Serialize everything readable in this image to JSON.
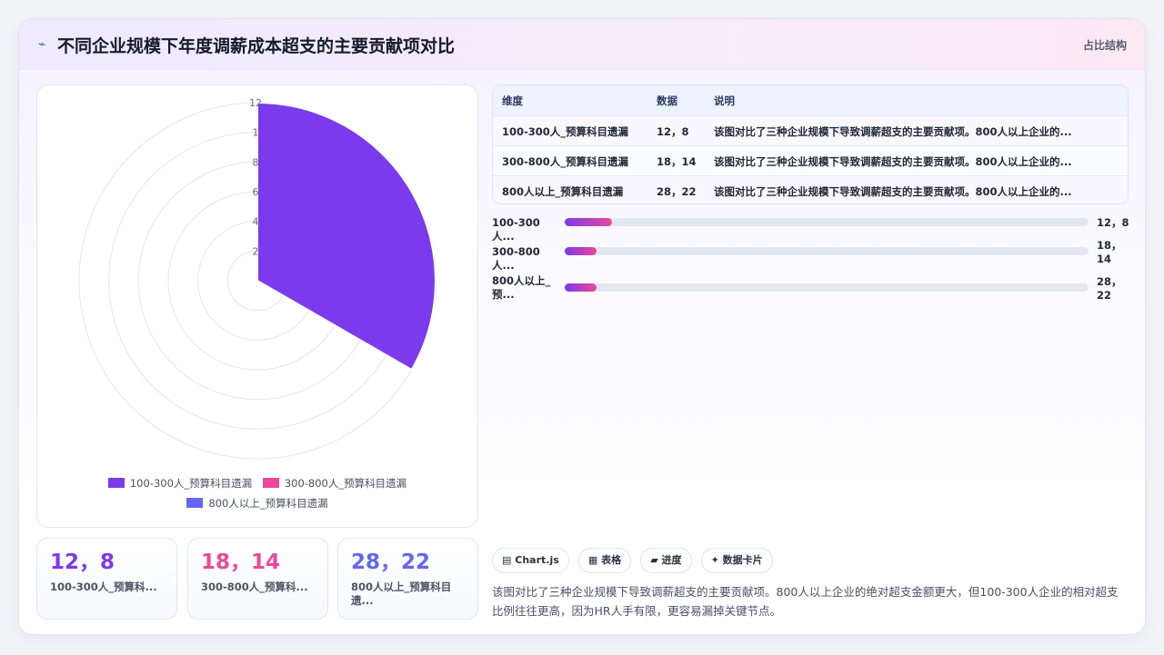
{
  "header": {
    "icon": "trend-icon",
    "title": "不同企业规模下年度调薪成本超支的主要贡献项对比",
    "tag": "占比结构"
  },
  "chart_data": {
    "type": "polarArea",
    "categories": [
      "100-300人_预算科目遗漏",
      "300-800人_预算科目遗漏",
      "800人以上_预算科目遗漏"
    ],
    "values": [
      12,
      18,
      28
    ],
    "colors": [
      "#7c3aed",
      "#ec4899",
      "#6366f1"
    ],
    "r_ticks": [
      "2",
      "4",
      "6",
      "8",
      "1",
      "12"
    ],
    "r_max": 12,
    "legend_position": "bottom",
    "grid": true
  },
  "legend": [
    {
      "label": "100-300人_预算科目遗漏",
      "color": "#7c3aed"
    },
    {
      "label": "300-800人_预算科目遗漏",
      "color": "#ec4899"
    },
    {
      "label": "800人以上_预算科目遗漏",
      "color": "#6366f1"
    }
  ],
  "kpis": [
    {
      "value": "12，8",
      "label": "100-300人_预算科...",
      "color": "#7c3aed"
    },
    {
      "value": "18，14",
      "label": "300-800人_预算科...",
      "color": "#ec4899"
    },
    {
      "value": "28，22",
      "label": "800人以上_预算科目遗...",
      "color": "#6366f1"
    }
  ],
  "table": {
    "headers": [
      "维度",
      "数据",
      "说明"
    ],
    "rows": [
      [
        "100-300人_预算科目遗漏",
        "12，8",
        "该图对比了三种企业规模下导致调薪超支的主要贡献项。800人以上企业的..."
      ],
      [
        "300-800人_预算科目遗漏",
        "18，14",
        "该图对比了三种企业规模下导致调薪超支的主要贡献项。800人以上企业的..."
      ],
      [
        "800人以上_预算科目遗漏",
        "28，22",
        "该图对比了三种企业规模下导致调薪超支的主要贡献项。800人以上企业的..."
      ]
    ]
  },
  "bars": [
    {
      "label": "100-300人...",
      "value": "12，8",
      "fraction": 0.09
    },
    {
      "label": "300-800人...",
      "value": "18，14",
      "fraction": 0.06
    },
    {
      "label": "800人以上_预...",
      "value": "28，22",
      "fraction": 0.06
    }
  ],
  "chips": [
    {
      "icon": "chart-icon",
      "glyph": "▤",
      "label": "Chart.js"
    },
    {
      "icon": "table-icon",
      "glyph": "▦",
      "label": "表格"
    },
    {
      "icon": "progress-icon",
      "glyph": "▰",
      "label": "进度"
    },
    {
      "icon": "sparkle-icon",
      "glyph": "✦",
      "label": "数据卡片"
    }
  ],
  "description": "该图对比了三种企业规模下导致调薪超支的主要贡献项。800人以上企业的绝对超支金额更大，但100-300人企业的相对超支比例往往更高，因为HR人手有限，更容易漏掉关键节点。"
}
